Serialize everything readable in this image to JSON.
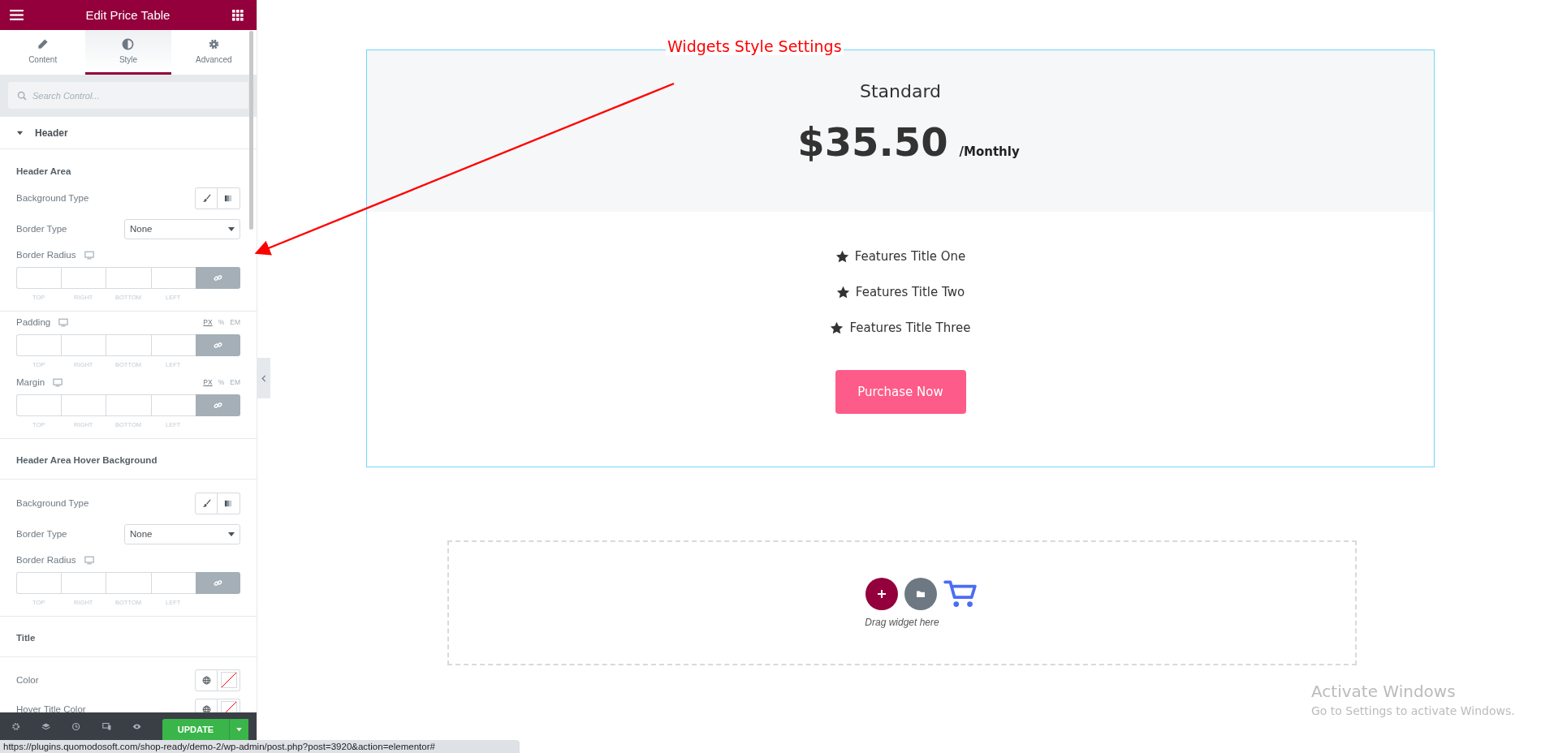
{
  "panel": {
    "title": "Edit Price Table",
    "tabs": [
      {
        "label": "Content",
        "selected": false
      },
      {
        "label": "Style",
        "selected": true
      },
      {
        "label": "Advanced",
        "selected": false
      }
    ],
    "search": {
      "placeholder": "Search Control..."
    },
    "controls": [
      {
        "kind": "section",
        "label": "Header",
        "expanded": true
      },
      {
        "kind": "heading",
        "label": "Header Area"
      },
      {
        "kind": "choose",
        "label": "Background Type"
      },
      {
        "kind": "select",
        "label": "Border Type",
        "value": "None"
      },
      {
        "kind": "dimensions",
        "label": "Border Radius",
        "fields": [
          "TOP",
          "RIGHT",
          "BOTTOM",
          "LEFT"
        ]
      },
      {
        "kind": "divider"
      },
      {
        "kind": "dimensions",
        "label": "Padding",
        "units": [
          {
            "label": "PX",
            "selected": true
          },
          {
            "label": "%",
            "selected": false
          },
          {
            "label": "EM",
            "selected": false
          }
        ],
        "fields": [
          "TOP",
          "RIGHT",
          "BOTTOM",
          "LEFT"
        ]
      },
      {
        "kind": "dimensions",
        "label": "Margin",
        "units": [
          {
            "label": "PX",
            "selected": true
          },
          {
            "label": "%",
            "selected": false
          },
          {
            "label": "EM",
            "selected": false
          }
        ],
        "fields": [
          "TOP",
          "RIGHT",
          "BOTTOM",
          "LEFT"
        ]
      },
      {
        "kind": "divider"
      },
      {
        "kind": "group_heading",
        "label": "Header Area Hover Background"
      },
      {
        "kind": "choose",
        "label": "Background Type"
      },
      {
        "kind": "select",
        "label": "Border Type",
        "value": "None"
      },
      {
        "kind": "dimensions",
        "label": "Border Radius",
        "fields": [
          "TOP",
          "RIGHT",
          "BOTTOM",
          "LEFT"
        ]
      },
      {
        "kind": "divider"
      },
      {
        "kind": "group_heading",
        "label": "Title"
      },
      {
        "kind": "color",
        "label": "Color"
      },
      {
        "kind": "color",
        "label": "Hover Title Color"
      }
    ],
    "update_button": "UPDATE"
  },
  "annotation": {
    "text": "Widgets Style Settings"
  },
  "price_table": {
    "title": "Standard",
    "price": "$35.50",
    "period": "/Monthly",
    "features": [
      "Features Title One",
      "Features Title Two",
      "Features Title Three"
    ],
    "button": "Purchase Now"
  },
  "drop_zone": {
    "text": "Drag widget here"
  },
  "activation_notice": {
    "title": "Activate Windows",
    "subtitle": "Go to Settings to activate Windows."
  },
  "status_bar": {
    "url": "https://plugins.quomodosoft.com/shop-ready/demo-2/wp-admin/post.php?post=3920&action=elementor#"
  }
}
